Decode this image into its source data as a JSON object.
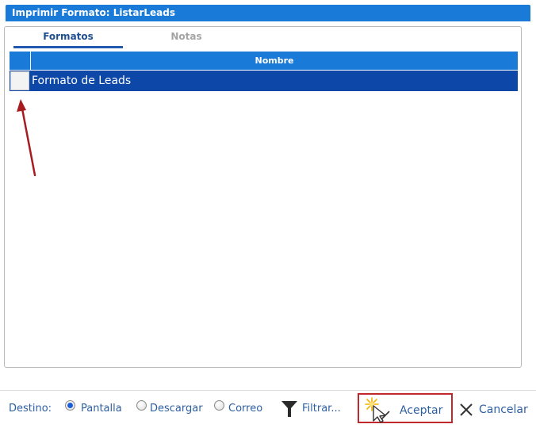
{
  "window": {
    "title": "Imprimir Formato: ListarLeads"
  },
  "tabs": [
    {
      "label": "Formatos",
      "active": true
    },
    {
      "label": "Notas",
      "active": false
    }
  ],
  "grid": {
    "columns": [
      "",
      "Nombre"
    ],
    "rows": [
      {
        "selected": false,
        "name": "Formato de Leads"
      }
    ]
  },
  "footer": {
    "destino_label": "Destino:",
    "destino_options": [
      {
        "label": "Pantalla",
        "checked": true
      },
      {
        "label": "Descargar",
        "checked": false
      },
      {
        "label": "Correo",
        "checked": false
      }
    ],
    "filter_label": "Filtrar...",
    "accept_label": "Aceptar",
    "cancel_label": "Cancelar"
  },
  "colors": {
    "title_bar": "#1a7ad8",
    "selected_row": "#0d47a8",
    "annotation_arrow": "#a51c21",
    "accept_highlight": "#c0282b"
  },
  "icons": [
    "filter-icon",
    "cursor-sparkle-icon",
    "close-icon",
    "annotation-arrow"
  ]
}
